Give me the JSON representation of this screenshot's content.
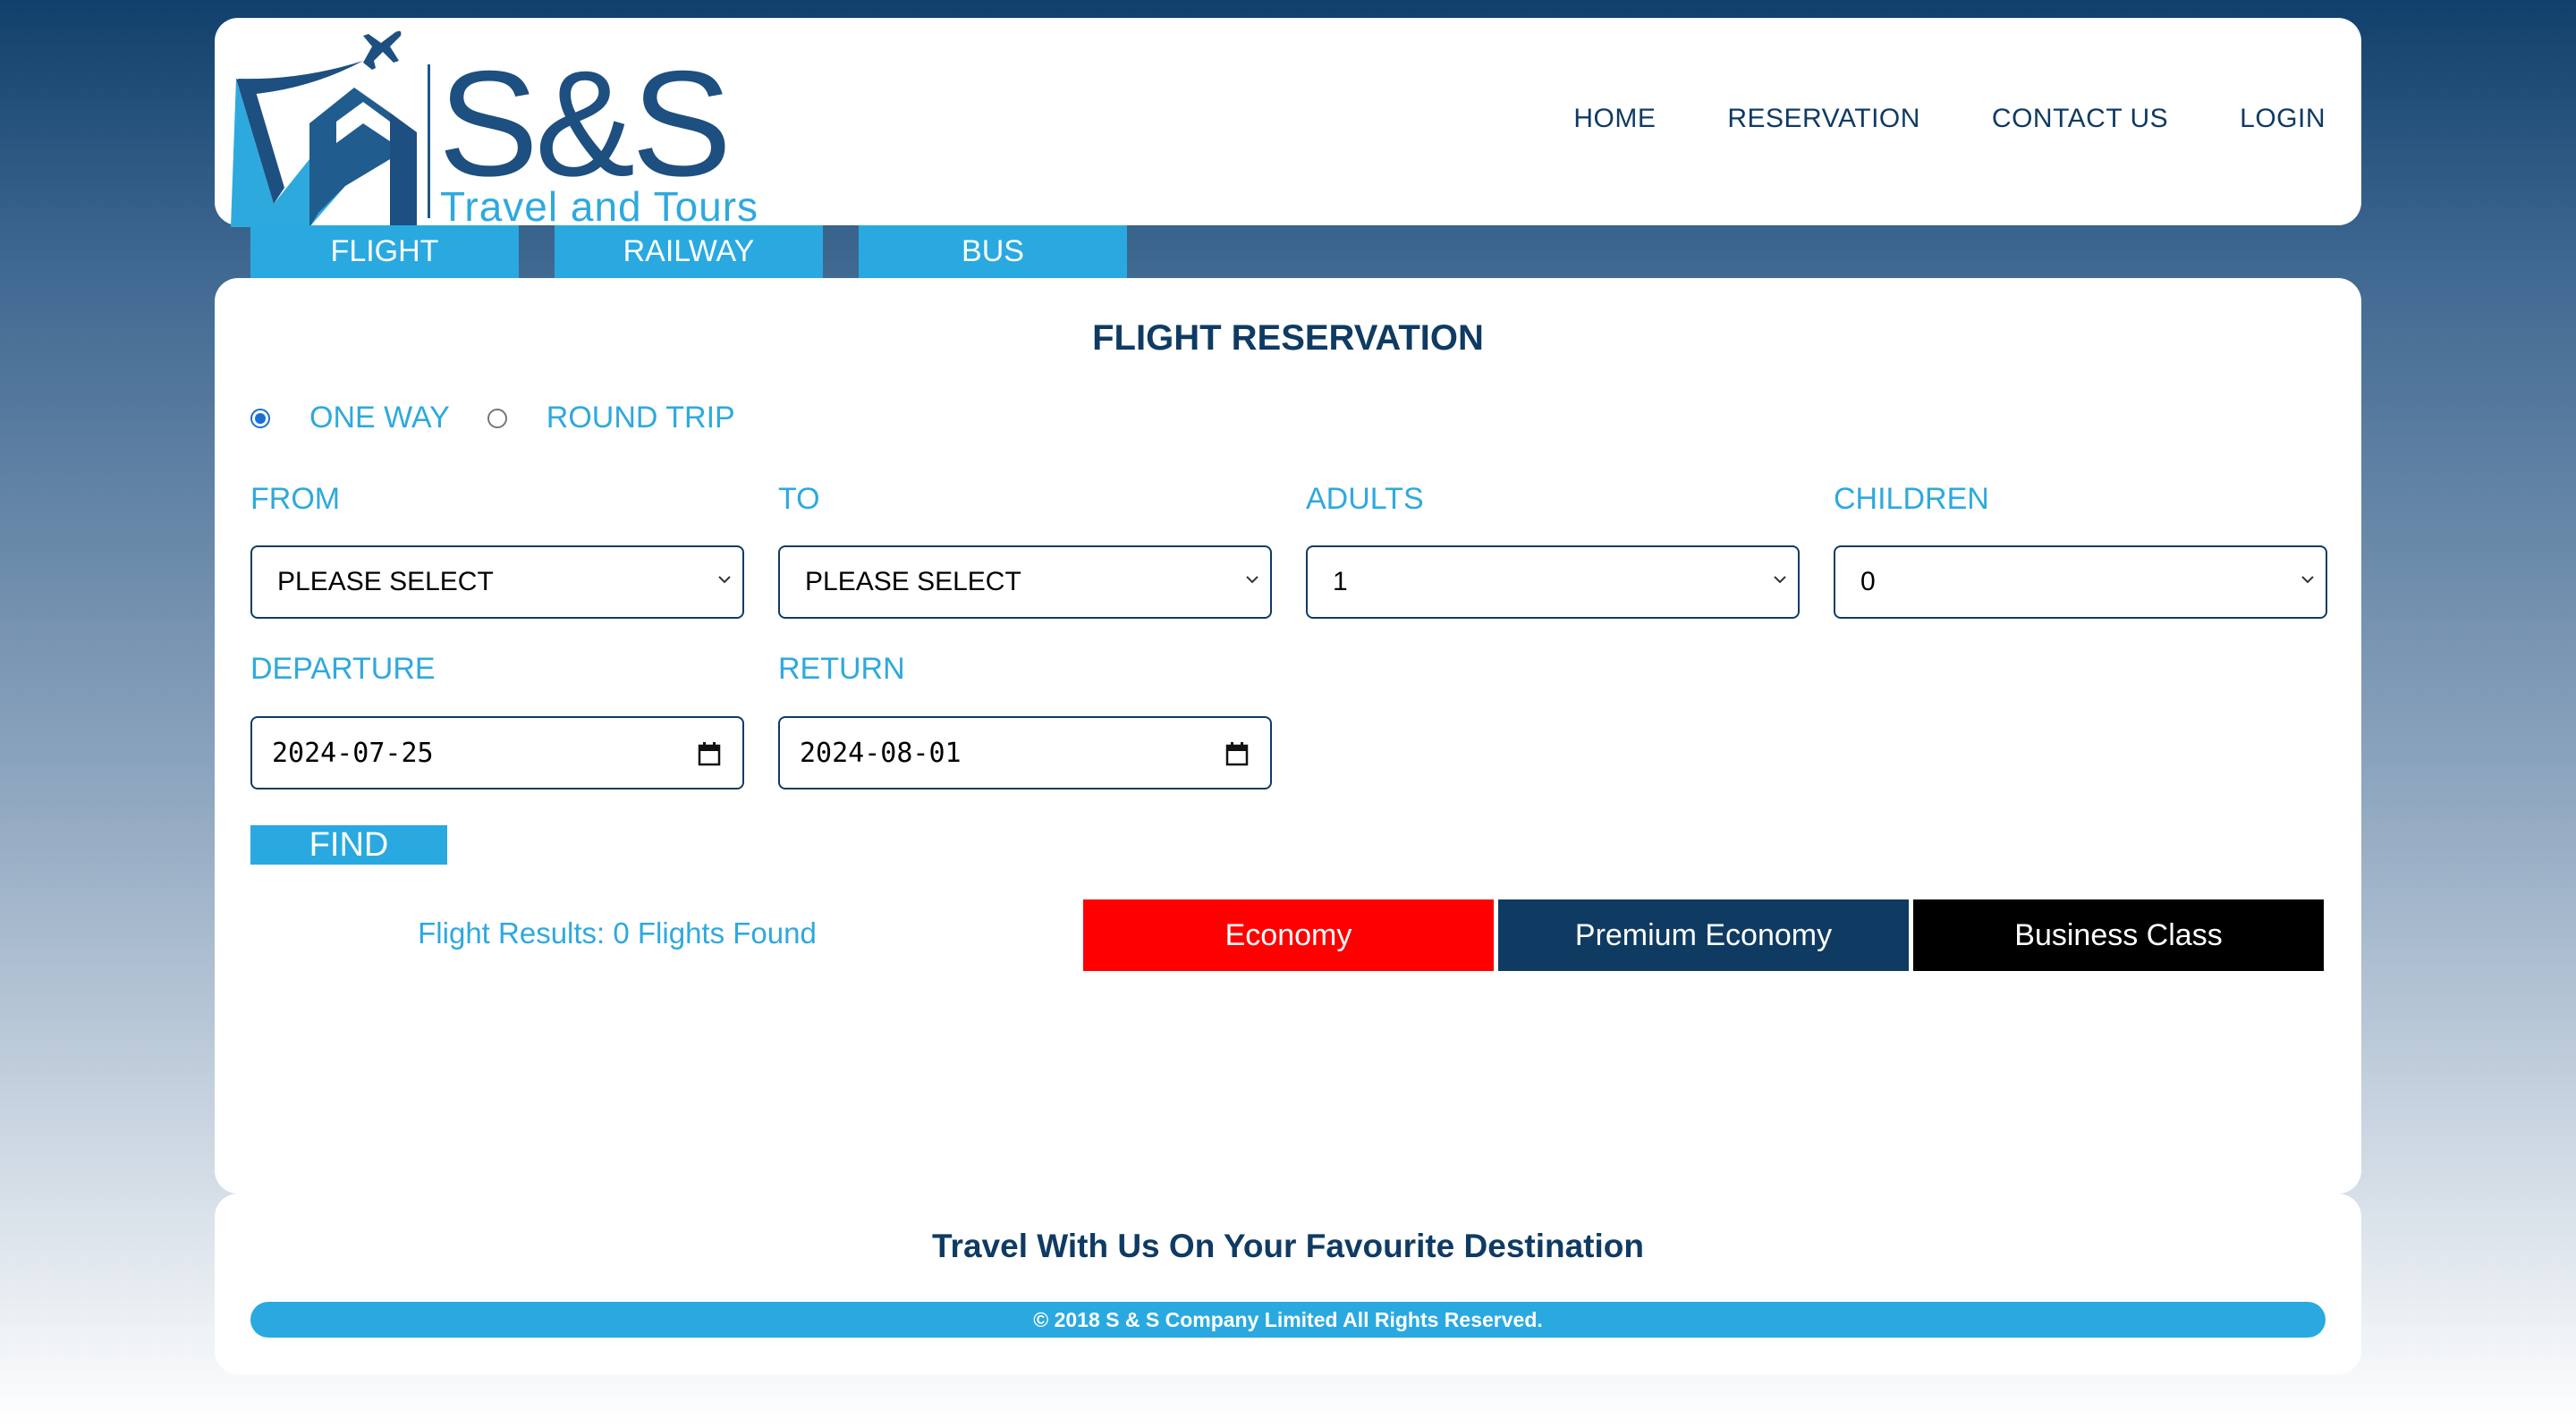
{
  "brand": {
    "title": "S&S",
    "subtitle": "Travel and Tours"
  },
  "nav": {
    "items": [
      {
        "label": "HOME"
      },
      {
        "label": "RESERVATION"
      },
      {
        "label": "CONTACT US"
      },
      {
        "label": "LOGIN"
      }
    ]
  },
  "tabs": [
    {
      "label": "FLIGHT"
    },
    {
      "label": "RAILWAY"
    },
    {
      "label": "BUS"
    }
  ],
  "form": {
    "title": "FLIGHT RESERVATION",
    "trip_types": [
      {
        "label": "ONE WAY",
        "selected": true
      },
      {
        "label": "ROUND TRIP",
        "selected": false
      }
    ],
    "from": {
      "label": "FROM",
      "value": "PLEASE SELECT"
    },
    "to": {
      "label": "TO",
      "value": "PLEASE SELECT"
    },
    "adults": {
      "label": "ADULTS",
      "value": "1"
    },
    "children": {
      "label": "CHILDREN",
      "value": "0"
    },
    "departure": {
      "label": "DEPARTURE",
      "value": "2024-07-25"
    },
    "return": {
      "label": "RETURN",
      "value": "2024-08-01"
    },
    "find_label": "FIND"
  },
  "results": {
    "text": "Flight Results: 0 Flights Found",
    "classes": [
      {
        "label": "Economy",
        "color": "#ff0000"
      },
      {
        "label": "Premium Economy",
        "color": "#0f3b63"
      },
      {
        "label": "Business Class",
        "color": "#000000"
      }
    ]
  },
  "footer": {
    "tagline": "Travel With Us On Your Favourite Destination",
    "copyright": "© 2018 S & S Company Limited All Rights Reserved."
  },
  "colors": {
    "accent": "#29a9e0",
    "navy": "#0f3b63"
  }
}
